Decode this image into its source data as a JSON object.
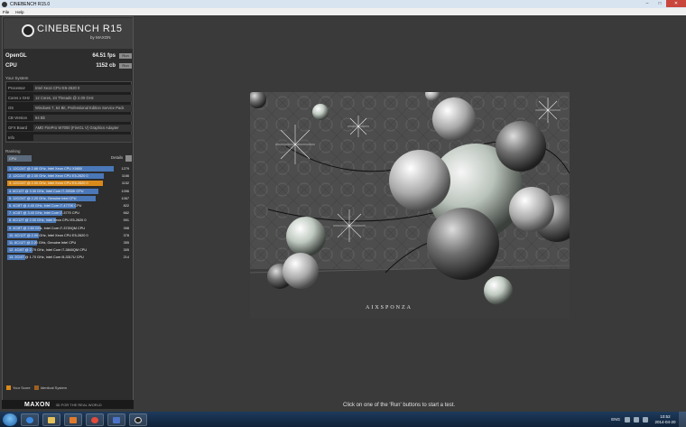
{
  "window": {
    "title": "CINEBENCH R15.0"
  },
  "menu": {
    "items": [
      "File",
      "Help"
    ]
  },
  "logo": {
    "title": "CINEBENCH R15",
    "subtitle": "by MAXON"
  },
  "scores": {
    "opengl": {
      "label": "OpenGL",
      "value": "64.51 fps",
      "run_label": "Run"
    },
    "cpu": {
      "label": "CPU",
      "value": "1152 cb",
      "run_label": "Run"
    }
  },
  "system": {
    "title": "Your System",
    "rows": [
      {
        "key": "Processor",
        "value": "Intel Xeon CPU E5-2620 0"
      },
      {
        "key": "Cores x GHz",
        "value": "12 Cores, 24 Threads @ 2.00 GHz"
      },
      {
        "key": "OS",
        "value": "Windows 7, 64 Bit, Professional Edition Service Pack"
      },
      {
        "key": "CB Version",
        "value": "64 Bit"
      },
      {
        "key": "GFX Board",
        "value": "AMD FirePro W7000 (FireGL V) Graphics Adapter"
      },
      {
        "key": "Info",
        "value": ""
      }
    ]
  },
  "ranking": {
    "title": "Ranking",
    "selected": "CPU",
    "details_label": "Details",
    "rows": [
      {
        "text": "1. 12C/24T @ 2.66 GHz, Intel Xeon CPU X5650",
        "score": "1279",
        "fill": 1.0,
        "color": "#4a78b8"
      },
      {
        "text": "2. 12C/24T @ 2.00 GHz, Intel Xeon CPU E5-2620 0",
        "score": "1166",
        "fill": 0.91,
        "color": "#4a78b8"
      },
      {
        "text": "3. 12C/24T @ 2.00 GHz, Intel Xeon CPU E5-2620 0",
        "score": "1152",
        "fill": 0.9,
        "color": "#d98a1a"
      },
      {
        "text": "4. 6C/12T @ 3.30 GHz, Intel Core i7-3930K CPU",
        "score": "1096",
        "fill": 0.86,
        "color": "#4a78b8"
      },
      {
        "text": "5. 12C/24T @ 2.20 GHz, Genuine Intel CPU",
        "score": "1067",
        "fill": 0.83,
        "color": "#4a78b8"
      },
      {
        "text": "6. 4C/8T @ 4.40 GHz, Intel Core i7-4770K CPU",
        "score": "822",
        "fill": 0.64,
        "color": "#4a78b8"
      },
      {
        "text": "7. 4C/8T @ 3.40 GHz, Intel Core i7-3770 CPU",
        "score": "662",
        "fill": 0.52,
        "color": "#4a78b8"
      },
      {
        "text": "8. 6C/12T @ 2.00 GHz, Intel Xeon CPU E5-2620 0",
        "score": "591",
        "fill": 0.46,
        "color": "#4a78b8"
      },
      {
        "text": "9. 4C/8T @ 2.60 GHz, Intel Core i7-3720QM CPU",
        "score": "398",
        "fill": 0.31,
        "color": "#4a78b8"
      },
      {
        "text": "10. 6C/12T @ 2.00 GHz, Intel Xeon CPU E5-2620 0",
        "score": "378",
        "fill": 0.3,
        "color": "#4a78b8"
      },
      {
        "text": "11. 6C/12T @ 2.20 GHz, Genuine Intel CPU",
        "score": "355",
        "fill": 0.28,
        "color": "#4a78b8"
      },
      {
        "text": "12. 4C/8T @ 2.79 GHz, Intel Core i7-3840QM CPU",
        "score": "305",
        "fill": 0.24,
        "color": "#4a78b8"
      },
      {
        "text": "13. 2C/4T @ 1.70 GHz, Intel Core i5-3317U CPU",
        "score": "214",
        "fill": 0.17,
        "color": "#4a78b8"
      }
    ]
  },
  "legend": {
    "your_score": "Your Score",
    "identical": "Identical System",
    "your_color": "#d98a1a",
    "identical_color": "#a06020"
  },
  "footer": {
    "brand": "MAXON",
    "tagline": "3D FOR THE REAL WORLD"
  },
  "status": {
    "message": "Click on one of the 'Run' buttons to start a test."
  },
  "render": {
    "watermark": "AIXSPONZA"
  },
  "taskbar": {
    "time": "10:52",
    "date": "2014-04-20",
    "lang": "ENG"
  }
}
